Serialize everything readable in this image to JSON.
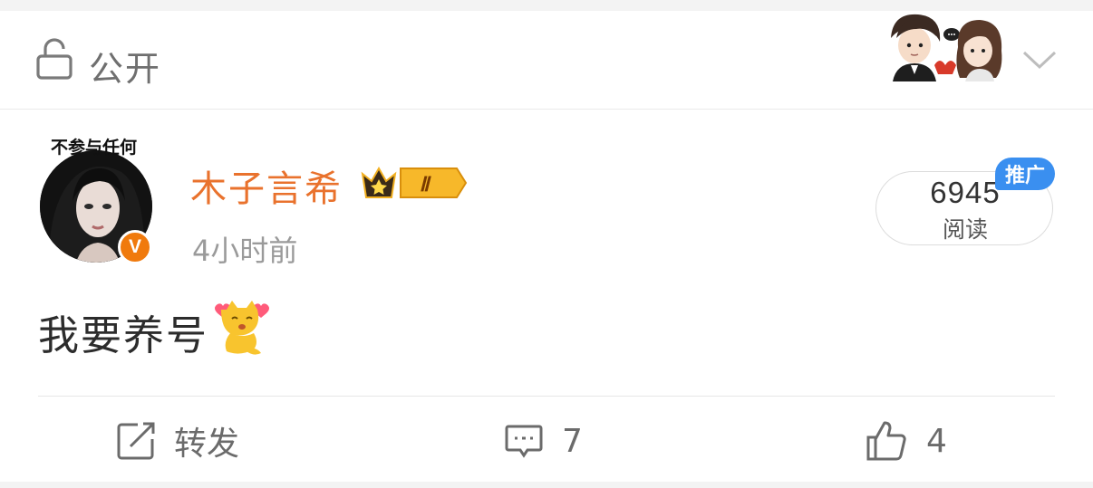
{
  "visibility": {
    "label": "公开",
    "icons": [
      "lock-open-icon",
      "chevron-down-icon"
    ]
  },
  "post": {
    "avatar_caption": "不参与任何",
    "verified_mark": "V",
    "author_name": "木子言希",
    "time": "4小时前",
    "reads": {
      "count": "6945",
      "label": "阅读",
      "promo_tag": "推广"
    },
    "text": "我要养号",
    "rank_badge": "Ⅱ"
  },
  "actions": {
    "repost_label": "转发",
    "comment_count": "7",
    "like_count": "4"
  },
  "colors": {
    "author_name": "#e9722d",
    "promo_tag": "#3a8ff0",
    "verified": "#f07a0d",
    "muted_text": "#9a9a9a"
  }
}
